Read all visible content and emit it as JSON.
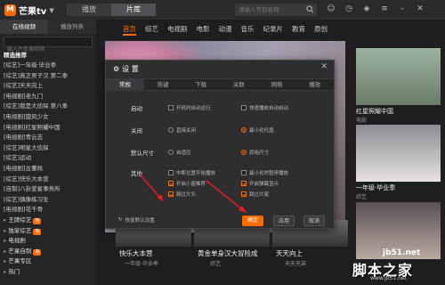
{
  "app": {
    "logo_text": "芒果tv",
    "logo_badge": "M"
  },
  "top_tabs": [
    "播放",
    "片库"
  ],
  "search": {
    "placeholder": "请输入节目名称"
  },
  "window_icons": [
    "user-icon",
    "clock-icon",
    "skin-icon",
    "menu-icon",
    "minimize-icon",
    "close-icon"
  ],
  "sidebar": {
    "tabs": [
      "在线视频",
      "播放列表"
    ],
    "search_placeholder": "输入片名搜视频",
    "section_title": "精选推荐",
    "items": [
      "[综艺]一年级·毕业季",
      "[综艺]真正男子汉 第二季",
      "[综艺]天天向上",
      "[电视剧]老九门",
      "[综艺]我是大侦探 第八季",
      "[电视剧]旋风少女",
      "[电视剧]红星照耀中国",
      "[电视剧]青云志",
      "[综艺]明星大侦探",
      "[综艺]运动",
      "[电视剧]古董局",
      "[综艺]快乐大本营",
      "[自制]八卦爱星事务所",
      "[综艺]偶像练习生",
      "[电视剧]花千骨"
    ],
    "categories": [
      {
        "label": "王牌综艺",
        "badge": "热"
      },
      {
        "label": "独家综艺",
        "badge": "热"
      },
      {
        "label": "电视剧",
        "badge": ""
      },
      {
        "label": "芒果自制",
        "badge": "热"
      },
      {
        "label": "芒果专区",
        "badge": ""
      },
      {
        "label": "热门",
        "badge": ""
      }
    ]
  },
  "nav_tabs": [
    "首页",
    "综艺",
    "电视剧",
    "电影",
    "动漫",
    "音乐",
    "纪录片",
    "教育",
    "原创"
  ],
  "right_column": [
    {
      "title": "红星照耀中国",
      "sub": "电影"
    },
    {
      "title": "一年级·毕业季",
      "sub": "综艺"
    },
    {
      "title": "",
      "sub": ""
    }
  ],
  "bottom_row": [
    {
      "title": "快乐大本营",
      "sub": "一年级·毕业季"
    },
    {
      "title": "黄金单身汉大冒险成",
      "sub": "综艺"
    },
    {
      "title": "天天向上",
      "sub": "天天兄弟"
    }
  ],
  "dialog": {
    "title": "设 置",
    "tabs": [
      "常规",
      "热键",
      "下载",
      "关联",
      "网络",
      "播放"
    ],
    "rows": [
      {
        "label": "启动",
        "options": [
          {
            "text": "开机时自动运行",
            "kind": "checkbox",
            "on": false
          },
          {
            "text": "快速播放自动启动",
            "kind": "checkbox",
            "on": false
          }
        ]
      },
      {
        "label": "关闭",
        "options": [
          {
            "text": "直接关闭",
            "kind": "radio",
            "on": false
          },
          {
            "text": "最小化托盘",
            "kind": "radio",
            "on": true
          }
        ]
      },
      {
        "label": "默认尺寸",
        "options": [
          {
            "text": "自适应",
            "kind": "radio",
            "on": false
          },
          {
            "text": "原始尺寸",
            "kind": "radio",
            "on": true
          }
        ]
      }
    ],
    "other_label": "其他",
    "other_options": [
      {
        "text": "中断位置开始播放",
        "on": false
      },
      {
        "text": "最小化时暂停播放",
        "on": false
      },
      {
        "text": "开启小窗推荐",
        "on": true
      },
      {
        "text": "开启弹幕显示",
        "on": true
      },
      {
        "text": "跳过片头",
        "on": true
      },
      {
        "text": "跳过片尾",
        "on": true
      }
    ],
    "reset_label": "恢复默认设置",
    "ok_label": "确定",
    "apply_label": "应用",
    "cancel_label": "取消"
  },
  "watermark": {
    "url": "jb51.net",
    "name": "脚本之家",
    "sub": "www.jb51.net"
  },
  "colors": {
    "accent": "#ff6a00",
    "annotation": "#e02020"
  }
}
